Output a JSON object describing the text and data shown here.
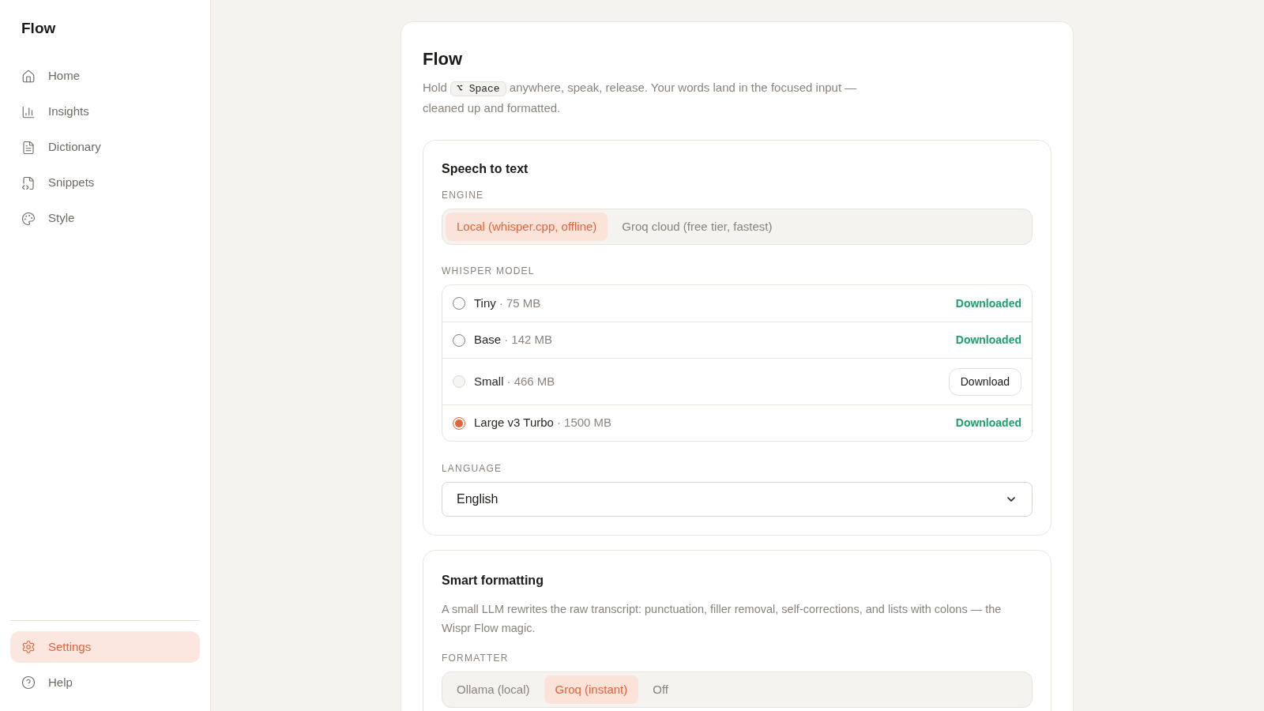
{
  "sidebar": {
    "title": "Flow",
    "items": [
      {
        "label": "Home",
        "kind": "home",
        "selected": false
      },
      {
        "label": "Insights",
        "kind": "chart",
        "selected": false
      },
      {
        "label": "Dictionary",
        "kind": "book",
        "selected": false
      },
      {
        "label": "Snippets",
        "kind": "snippet",
        "selected": false
      },
      {
        "label": "Style",
        "kind": "palette",
        "selected": false
      }
    ],
    "bottom_items": [
      {
        "label": "Settings",
        "kind": "gear",
        "selected": true
      },
      {
        "label": "Help",
        "kind": "help",
        "selected": false
      }
    ]
  },
  "page": {
    "title": "Flow",
    "description_before": "Hold",
    "shortcut": "⌥ Space",
    "description_after": "anywhere, speak, release. Your words land in the focused input — cleaned up and formatted."
  },
  "speech_to_text": {
    "title": "Speech to text",
    "engine_label": "ENGINE",
    "engines": [
      {
        "label": "Local (whisper.cpp, offline)",
        "selected": true
      },
      {
        "label": "Groq cloud (free tier, fastest)",
        "selected": false
      }
    ],
    "model_label": "WHISPER MODEL",
    "models": [
      {
        "name": "Tiny",
        "size": "· 75 MB",
        "selected": false,
        "disabled": false,
        "kind": "status",
        "status": "Downloaded"
      },
      {
        "name": "Base",
        "size": "· 142 MB",
        "selected": false,
        "disabled": false,
        "kind": "status",
        "status": "Downloaded"
      },
      {
        "name": "Small",
        "size": "· 466 MB",
        "selected": false,
        "disabled": true,
        "kind": "button",
        "status": "Download"
      },
      {
        "name": "Large v3 Turbo",
        "size": "· 1500 MB",
        "selected": true,
        "disabled": false,
        "kind": "status",
        "status": "Downloaded"
      }
    ],
    "language_label": "LANGUAGE",
    "language": "English"
  },
  "smart_formatting": {
    "title": "Smart formatting",
    "description": "A small LLM rewrites the raw transcript: punctuation, filler removal, self-corrections, and lists with colons — the Wispr Flow magic.",
    "formatter_label": "FORMATTER",
    "formatters": [
      {
        "label": "Ollama (local)",
        "selected": false
      },
      {
        "label": "Groq (instant)",
        "selected": true
      },
      {
        "label": "Off",
        "selected": false
      }
    ]
  }
}
